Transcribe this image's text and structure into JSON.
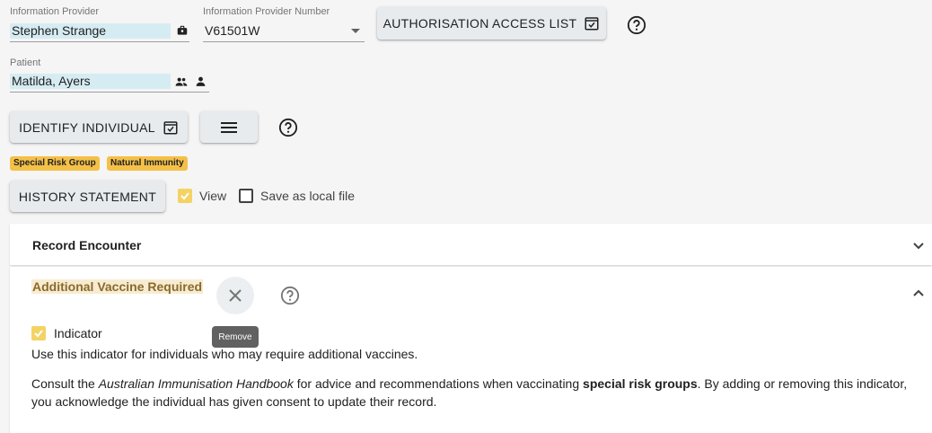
{
  "provider": {
    "label": "Information Provider",
    "value": "Stephen Strange",
    "number_label": "Information Provider Number",
    "number_value": "V61501W",
    "auth_button": "AUTHORISATION ACCESS LIST"
  },
  "patient": {
    "label": "Patient",
    "value": "Matilda, Ayers"
  },
  "actions": {
    "identify_button": "IDENTIFY INDIVIDUAL",
    "history_button": "HISTORY STATEMENT",
    "view_label": "View",
    "save_local_label": "Save as local file"
  },
  "badges": [
    "Special Risk Group",
    "Natural Immunity"
  ],
  "panels": {
    "record_encounter": "Record Encounter",
    "additional_vaccine": "Additional Vaccine Required",
    "tooltip_remove": "Remove",
    "indicator_label": "Indicator",
    "indicator_desc": "Use this indicator for individuals who may require additional vaccines.",
    "consult_pre": "Consult the ",
    "consult_handbook": "Australian Immunisation Handbook",
    "consult_mid": " for advice and recommendations when vaccinating ",
    "consult_bold": "special risk groups",
    "consult_post": ". By adding or removing this indicator, you acknowledge the individual has given consent to update their record."
  },
  "colors": {
    "badge": "#f4c048",
    "highlight": "#d6ecf3",
    "button": "#e7ebee"
  }
}
